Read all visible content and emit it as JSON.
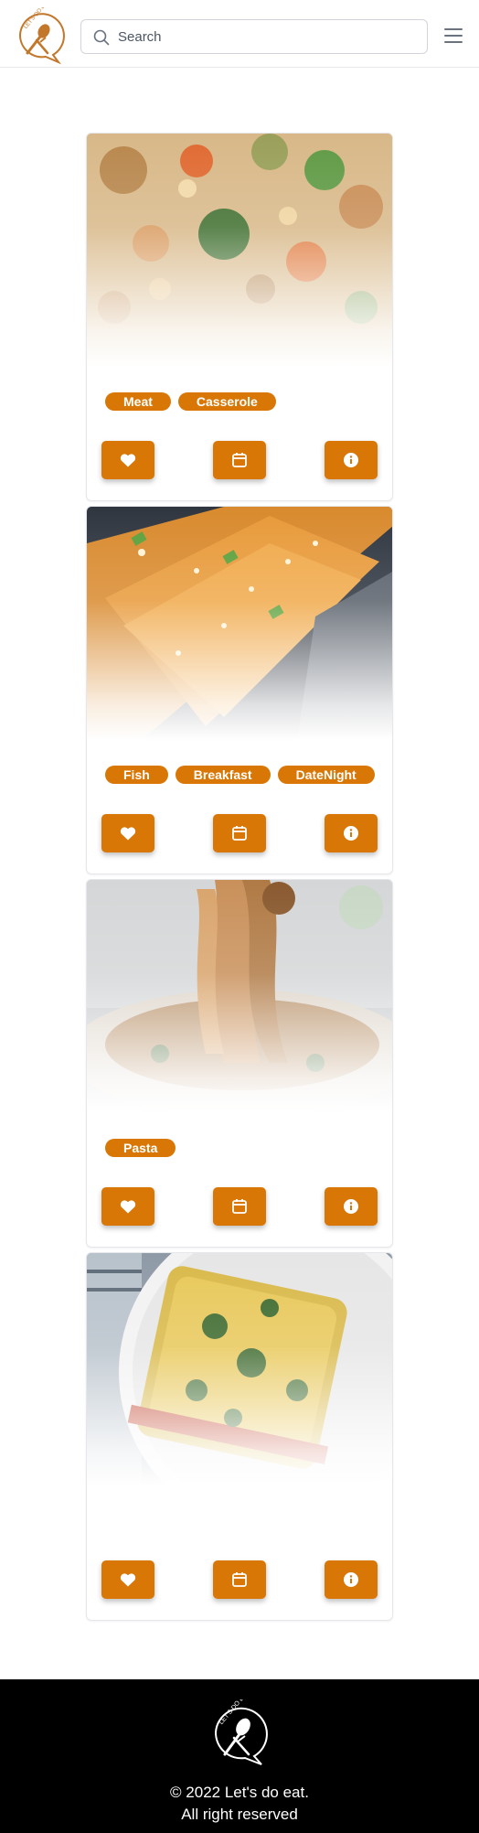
{
  "header": {
    "logo_text": "LET'S DO EAT",
    "search": {
      "placeholder": "Search",
      "value": ""
    }
  },
  "brand_color": "#d97706",
  "recipes": [
    {
      "image": "fried rice with vegetables",
      "tags": [
        "Meat",
        "Casserole"
      ]
    },
    {
      "image": "glazed salmon with sesame",
      "tags": [
        "Fish",
        "Breakfast",
        "DateNight"
      ]
    },
    {
      "image": "pasta noodles on fork",
      "tags": [
        "Pasta"
      ]
    },
    {
      "image": "lasagna with herbs",
      "tags": []
    }
  ],
  "card_actions": [
    {
      "icon": "heart-icon"
    },
    {
      "icon": "calendar-icon"
    },
    {
      "icon": "info-icon"
    }
  ],
  "footer": {
    "logo_text": "LET'S DO EAT",
    "copyright": "© 2022 Let's do eat.",
    "rights": "All right reserved"
  }
}
